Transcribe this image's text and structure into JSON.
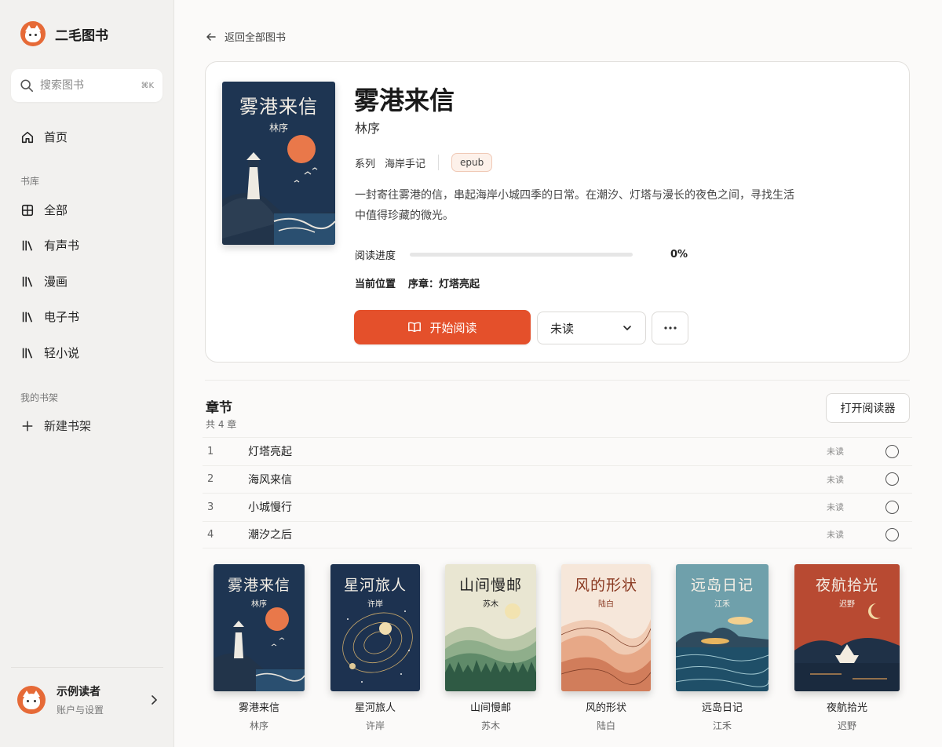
{
  "app": {
    "name": "二毛图书"
  },
  "search": {
    "placeholder": "搜索图书",
    "shortcut": "⌘K"
  },
  "nav": {
    "home": "首页",
    "library_label": "书库",
    "library_items": [
      "全部",
      "有声书",
      "漫画",
      "电子书",
      "轻小说"
    ],
    "shelves_label": "我的书架",
    "new_shelf": "新建书架"
  },
  "user": {
    "name": "示例读者",
    "subtitle": "账户与设置"
  },
  "back_label": "返回全部图书",
  "book": {
    "title": "雾港来信",
    "author": "林序",
    "series_label": "系列",
    "series": "海岸手记",
    "format": "epub",
    "description": "一封寄往雾港的信，串起海岸小城四季的日常。在潮汐、灯塔与漫长的夜色之间，寻找生活中值得珍藏的微光。",
    "progress_label": "阅读进度",
    "progress_value": 0,
    "progress_text": "0%",
    "position_label": "当前位置",
    "position_value": "序章：灯塔亮起",
    "start_button": "开始阅读",
    "status_select": "未读"
  },
  "chapters": {
    "title": "章节",
    "count": "共 4 章",
    "open_reader": "打开阅读器",
    "items": [
      {
        "num": "1",
        "name": "灯塔亮起",
        "status": "未读"
      },
      {
        "num": "2",
        "name": "海风来信",
        "status": "未读"
      },
      {
        "num": "3",
        "name": "小城慢行",
        "status": "未读"
      },
      {
        "num": "4",
        "name": "潮汐之后",
        "status": "未读"
      }
    ]
  },
  "shelf": [
    {
      "title": "雾港来信",
      "author": "林序",
      "cover": "lighthouse"
    },
    {
      "title": "星河旅人",
      "author": "许岸",
      "cover": "galaxy"
    },
    {
      "title": "山间慢邮",
      "author": "苏木",
      "cover": "mountains"
    },
    {
      "title": "风的形状",
      "author": "陆白",
      "cover": "waves"
    },
    {
      "title": "远岛日记",
      "author": "江禾",
      "cover": "island"
    },
    {
      "title": "夜航拾光",
      "author": "迟野",
      "cover": "boat"
    }
  ],
  "colors": {
    "accent": "#e4502b",
    "navy": "#1e3552"
  }
}
